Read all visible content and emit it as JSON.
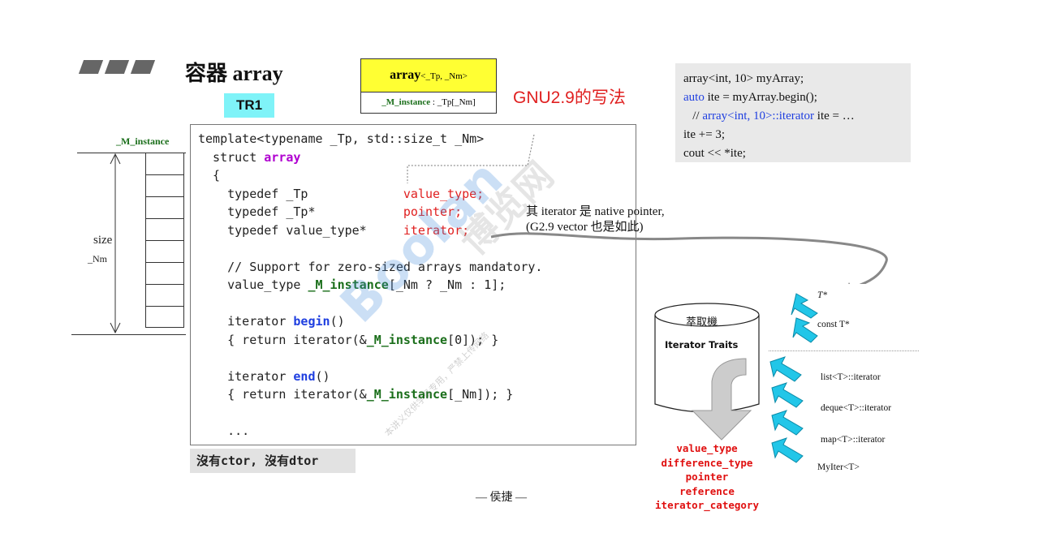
{
  "title": {
    "text": "容器 array"
  },
  "tr1": "TR1",
  "array_box": {
    "name": "array",
    "params": "<_Tp, _Nm>",
    "member_name": "_M_instance",
    "member_rest": ": _Tp[_Nm]"
  },
  "gnu_note": "GNU2.9的写法",
  "example": {
    "line1": "array<int, 10> myArray;",
    "line2_kw": "auto",
    "line2_rest": " ite = myArray.begin();",
    "line3_prefix": "   // ",
    "line3_blue": "array<int, 10>::iterator",
    "line3_rest": " ite = …",
    "line4": "ite += 3;",
    "line5": "cout << *ite;"
  },
  "memory": {
    "instance_label": "_M_instance",
    "size_label": "size",
    "nm_label": "_Nm"
  },
  "code": {
    "l1": "template<typename _Tp, std::size_t _Nm>",
    "l2a": "  struct ",
    "l2b": "array",
    "l3": "  {",
    "l4a": "    typedef _Tp             ",
    "l4b": "value_type;",
    "l5a": "    typedef _Tp*            ",
    "l5b": "pointer;",
    "l6a": "    typedef value_type*     ",
    "l6b": "iterator;",
    "l8": "    // Support for zero-sized arrays mandatory.",
    "l9a": "    value_type ",
    "l9b": "_M_instance",
    "l9c": "[_Nm ? _Nm : 1];",
    "l11a": "    iterator ",
    "l11b": "begin",
    "l11c": "()",
    "l12a": "    { return iterator(&",
    "l12b": "_M_instance",
    "l12c": "[0]); }",
    "l14a": "    iterator ",
    "l14b": "end",
    "l14c": "()",
    "l15a": "    { return iterator(&",
    "l15b": "_M_instance",
    "l15c": "[_Nm]); }",
    "l17": "    ..."
  },
  "no_ctor": "沒有ctor, 沒有dtor",
  "author": "— 侯捷 —",
  "native_note": {
    "line1": "其 iterator 是 native pointer,",
    "line2": "(G2.9 vector 也是如此)"
  },
  "traits": {
    "cylinder_top": "萃取機",
    "cylinder_label": "Iterator Traits",
    "inputs": [
      "T*",
      "const T*",
      "list<T>::iterator",
      "deque<T>::iterator",
      "map<T>::iterator",
      "MyIter<T>"
    ],
    "outputs": [
      "value_type",
      "difference_type",
      "pointer",
      "reference",
      "iterator_category"
    ]
  },
  "watermark": {
    "main": "Boolan",
    "cn": "博览网",
    "small": "本讲义仅供学员专用，严禁上传网络"
  },
  "colors": {
    "yellow": "#ffff33",
    "cyan": "#7ff3f8",
    "arrow_cyan": "#22c6e8",
    "red": "#e02020",
    "green": "#1a6e1a"
  }
}
